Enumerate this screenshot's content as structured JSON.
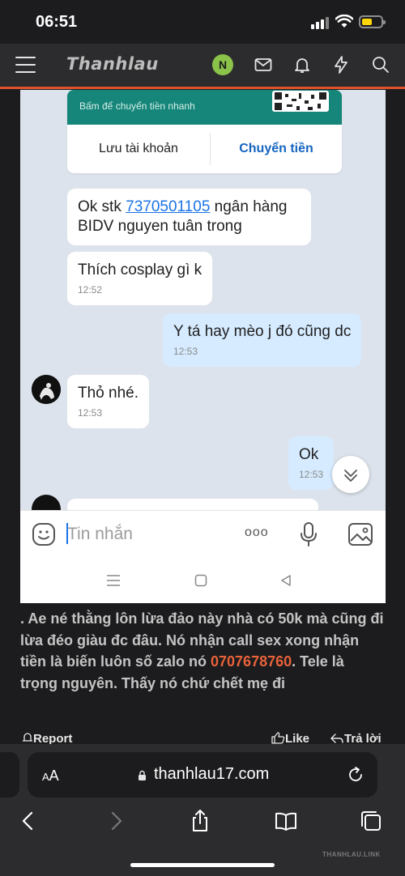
{
  "status_bar": {
    "time": "06:51",
    "battery_color": "#ffd60a"
  },
  "site_header": {
    "logo": "Thanhlau",
    "user_initial": "N",
    "icons": [
      "menu-icon",
      "mail-icon",
      "bell-icon",
      "lightning-icon",
      "search-icon"
    ],
    "accent_color": "#e2522a"
  },
  "chat": {
    "card": {
      "subtitle": "Bấm để chuyển tiền nhanh",
      "save_account_label": "Lưu tài khoản",
      "transfer_label": "Chuyển tiền"
    },
    "messages": [
      {
        "text_before": "Ok stk ",
        "link": "7370501105",
        "text_after": " ngân hàng BIDV nguyen tuân trong",
        "time": "",
        "mine": false
      },
      {
        "text": "Thích cosplay gì k",
        "time": "12:52",
        "mine": false
      },
      {
        "text": "Y tá hay mèo j đó cũng dc",
        "time": "12:53",
        "mine": true
      },
      {
        "text": "Thỏ nhé.",
        "time": "12:53",
        "mine": false
      },
      {
        "text": "Ok",
        "time": "12:53",
        "mine": true
      }
    ],
    "input_placeholder": "Tin nhắn",
    "more_label": "ooo"
  },
  "post": {
    "text_before": ". Ae né thằng lôn lừa đảo này nhà có 50k mà cũng đi lừa đéo giàu đc đâu. Nó nhận call sex xong nhận tiền là biến luôn số zalo nó ",
    "phone": "0707678760",
    "text_after": ". Tele là trọng nguyên. Thấy nó chứ chết mẹ đi",
    "report_label": "Report",
    "like_label": "Like",
    "reply_label": "Trả lời"
  },
  "browser": {
    "aa_small": "A",
    "aa_large": "A",
    "url": "thanhlau17.com",
    "watermark": "THANHLAU.LINK"
  }
}
